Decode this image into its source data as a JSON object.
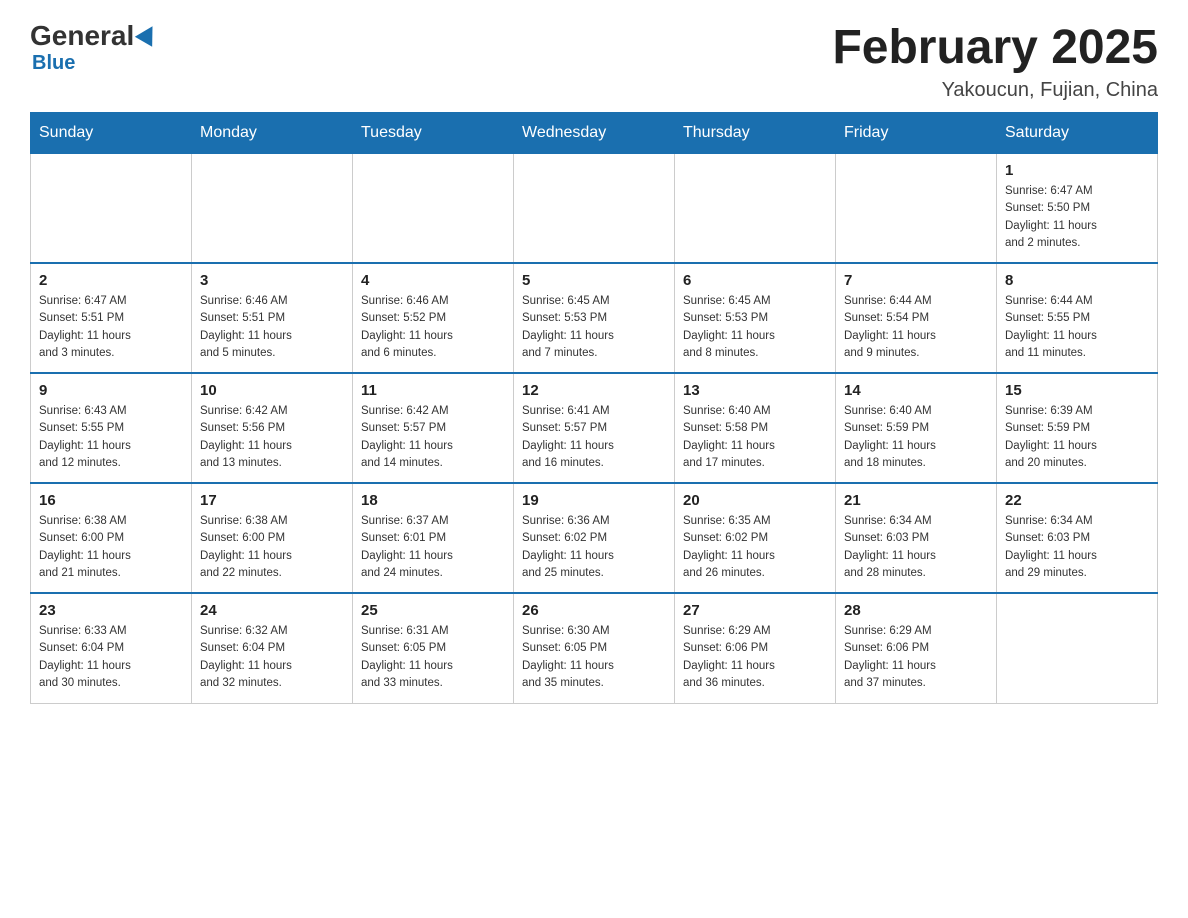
{
  "header": {
    "logo": {
      "general": "General",
      "blue": "Blue"
    },
    "title": "February 2025",
    "location": "Yakoucun, Fujian, China"
  },
  "weekdays": [
    "Sunday",
    "Monday",
    "Tuesday",
    "Wednesday",
    "Thursday",
    "Friday",
    "Saturday"
  ],
  "weeks": [
    [
      {
        "day": "",
        "info": ""
      },
      {
        "day": "",
        "info": ""
      },
      {
        "day": "",
        "info": ""
      },
      {
        "day": "",
        "info": ""
      },
      {
        "day": "",
        "info": ""
      },
      {
        "day": "",
        "info": ""
      },
      {
        "day": "1",
        "info": "Sunrise: 6:47 AM\nSunset: 5:50 PM\nDaylight: 11 hours\nand 2 minutes."
      }
    ],
    [
      {
        "day": "2",
        "info": "Sunrise: 6:47 AM\nSunset: 5:51 PM\nDaylight: 11 hours\nand 3 minutes."
      },
      {
        "day": "3",
        "info": "Sunrise: 6:46 AM\nSunset: 5:51 PM\nDaylight: 11 hours\nand 5 minutes."
      },
      {
        "day": "4",
        "info": "Sunrise: 6:46 AM\nSunset: 5:52 PM\nDaylight: 11 hours\nand 6 minutes."
      },
      {
        "day": "5",
        "info": "Sunrise: 6:45 AM\nSunset: 5:53 PM\nDaylight: 11 hours\nand 7 minutes."
      },
      {
        "day": "6",
        "info": "Sunrise: 6:45 AM\nSunset: 5:53 PM\nDaylight: 11 hours\nand 8 minutes."
      },
      {
        "day": "7",
        "info": "Sunrise: 6:44 AM\nSunset: 5:54 PM\nDaylight: 11 hours\nand 9 minutes."
      },
      {
        "day": "8",
        "info": "Sunrise: 6:44 AM\nSunset: 5:55 PM\nDaylight: 11 hours\nand 11 minutes."
      }
    ],
    [
      {
        "day": "9",
        "info": "Sunrise: 6:43 AM\nSunset: 5:55 PM\nDaylight: 11 hours\nand 12 minutes."
      },
      {
        "day": "10",
        "info": "Sunrise: 6:42 AM\nSunset: 5:56 PM\nDaylight: 11 hours\nand 13 minutes."
      },
      {
        "day": "11",
        "info": "Sunrise: 6:42 AM\nSunset: 5:57 PM\nDaylight: 11 hours\nand 14 minutes."
      },
      {
        "day": "12",
        "info": "Sunrise: 6:41 AM\nSunset: 5:57 PM\nDaylight: 11 hours\nand 16 minutes."
      },
      {
        "day": "13",
        "info": "Sunrise: 6:40 AM\nSunset: 5:58 PM\nDaylight: 11 hours\nand 17 minutes."
      },
      {
        "day": "14",
        "info": "Sunrise: 6:40 AM\nSunset: 5:59 PM\nDaylight: 11 hours\nand 18 minutes."
      },
      {
        "day": "15",
        "info": "Sunrise: 6:39 AM\nSunset: 5:59 PM\nDaylight: 11 hours\nand 20 minutes."
      }
    ],
    [
      {
        "day": "16",
        "info": "Sunrise: 6:38 AM\nSunset: 6:00 PM\nDaylight: 11 hours\nand 21 minutes."
      },
      {
        "day": "17",
        "info": "Sunrise: 6:38 AM\nSunset: 6:00 PM\nDaylight: 11 hours\nand 22 minutes."
      },
      {
        "day": "18",
        "info": "Sunrise: 6:37 AM\nSunset: 6:01 PM\nDaylight: 11 hours\nand 24 minutes."
      },
      {
        "day": "19",
        "info": "Sunrise: 6:36 AM\nSunset: 6:02 PM\nDaylight: 11 hours\nand 25 minutes."
      },
      {
        "day": "20",
        "info": "Sunrise: 6:35 AM\nSunset: 6:02 PM\nDaylight: 11 hours\nand 26 minutes."
      },
      {
        "day": "21",
        "info": "Sunrise: 6:34 AM\nSunset: 6:03 PM\nDaylight: 11 hours\nand 28 minutes."
      },
      {
        "day": "22",
        "info": "Sunrise: 6:34 AM\nSunset: 6:03 PM\nDaylight: 11 hours\nand 29 minutes."
      }
    ],
    [
      {
        "day": "23",
        "info": "Sunrise: 6:33 AM\nSunset: 6:04 PM\nDaylight: 11 hours\nand 30 minutes."
      },
      {
        "day": "24",
        "info": "Sunrise: 6:32 AM\nSunset: 6:04 PM\nDaylight: 11 hours\nand 32 minutes."
      },
      {
        "day": "25",
        "info": "Sunrise: 6:31 AM\nSunset: 6:05 PM\nDaylight: 11 hours\nand 33 minutes."
      },
      {
        "day": "26",
        "info": "Sunrise: 6:30 AM\nSunset: 6:05 PM\nDaylight: 11 hours\nand 35 minutes."
      },
      {
        "day": "27",
        "info": "Sunrise: 6:29 AM\nSunset: 6:06 PM\nDaylight: 11 hours\nand 36 minutes."
      },
      {
        "day": "28",
        "info": "Sunrise: 6:29 AM\nSunset: 6:06 PM\nDaylight: 11 hours\nand 37 minutes."
      },
      {
        "day": "",
        "info": ""
      }
    ]
  ]
}
